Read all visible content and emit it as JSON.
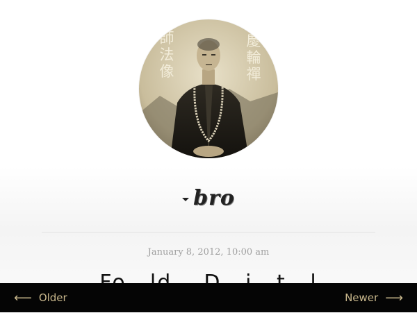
{
  "site": {
    "title": "bro"
  },
  "post": {
    "date": "January 8, 2012, 10:00 am",
    "title": "Fo...ld... D...i...t...l"
  },
  "nav": {
    "older_label": "Older",
    "newer_label": "Newer",
    "older_icon": "arrow-left-icon",
    "newer_icon": "arrow-right-icon"
  },
  "avatar": {
    "caption_left": "師法像",
    "caption_right": "慶輪禪"
  },
  "colors": {
    "nav_background": "#050505",
    "nav_text": "#c8b78c",
    "date_text": "#a0a0a0"
  }
}
